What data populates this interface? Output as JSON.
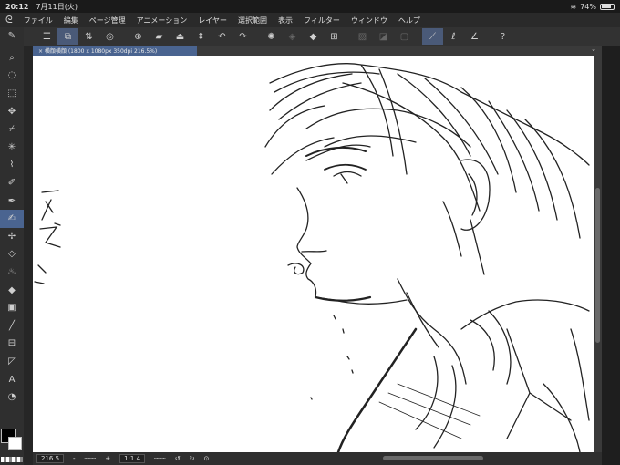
{
  "status": {
    "time": "20:12",
    "date": "7月11日(火)",
    "battery": "74%"
  },
  "menu": [
    "ファイル",
    "編集",
    "ページ管理",
    "アニメーション",
    "レイヤー",
    "選択範囲",
    "表示",
    "フィルター",
    "ウィンドウ",
    "ヘルプ"
  ],
  "tab": {
    "title": "× 横顔横顔 (1800 x 1080px 350dpi 216.5%)"
  },
  "bottom": {
    "zoom": "216.5",
    "minus": "-",
    "plus": "+",
    "ratio": "1:1.4"
  },
  "tools": [
    "pen-icon",
    "zoom-icon",
    "lasso-icon",
    "select-icon",
    "move-icon",
    "eyedropper-icon",
    "wand-icon",
    "dropper-icon",
    "pencil-icon",
    "pen-tool-icon",
    "brush-icon",
    "airbrush-icon",
    "eraser-icon",
    "blend-icon",
    "fill-icon",
    "gradient-icon",
    "line-icon",
    "frame-icon",
    "text-icon",
    "balloon-icon"
  ],
  "colors": {
    "accent": "#4a6490",
    "canvas": "#ffffff",
    "ui": "#2b2b2b"
  }
}
